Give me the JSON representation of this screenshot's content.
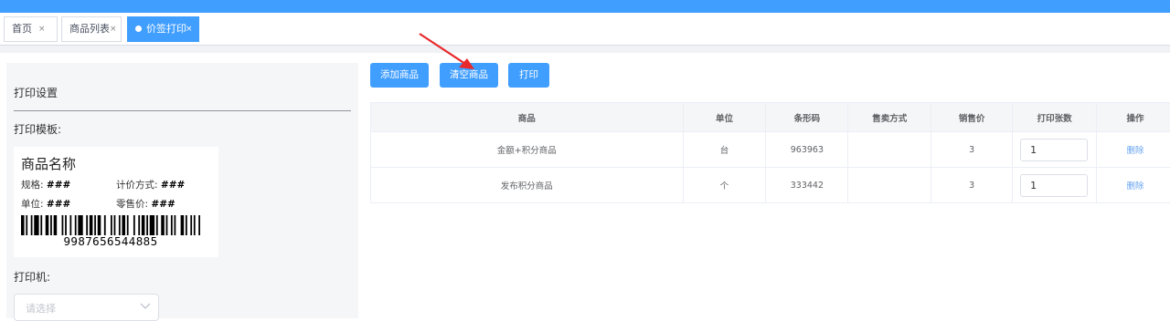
{
  "tabs": [
    {
      "label": "首页",
      "close": "×"
    },
    {
      "label": "商品列表",
      "close": "×"
    },
    {
      "label": "价签打印",
      "close": "×",
      "active": true
    }
  ],
  "settings": {
    "title": "打印设置",
    "template_label": "打印模板:",
    "printer_label": "打印机:",
    "printer_placeholder": "请选择"
  },
  "template": {
    "name": "商品名称",
    "spec_label": "规格:",
    "spec_value": "###",
    "pricing_label": "计价方式:",
    "pricing_value": "###",
    "unit_label": "单位:",
    "unit_value": "###",
    "retail_label": "零售价:",
    "retail_value": "###",
    "barcode": "9987656544885"
  },
  "toolbar": {
    "add_label": "添加商品",
    "clear_label": "清空商品",
    "print_label": "打印"
  },
  "table": {
    "headers": [
      "商品",
      "单位",
      "条形码",
      "售卖方式",
      "销售价",
      "打印张数",
      "操作"
    ],
    "rows": [
      {
        "name": "金额+积分商品",
        "unit": "台",
        "barcode": "963963",
        "sale_mode": "",
        "price": "3",
        "copies": "1",
        "action": "删除"
      },
      {
        "name": "发布积分商品",
        "unit": "个",
        "barcode": "333442",
        "sale_mode": "",
        "price": "3",
        "copies": "1",
        "action": "删除"
      }
    ]
  },
  "colors": {
    "primary": "#409eff",
    "annotation_arrow": "#e8282b"
  }
}
